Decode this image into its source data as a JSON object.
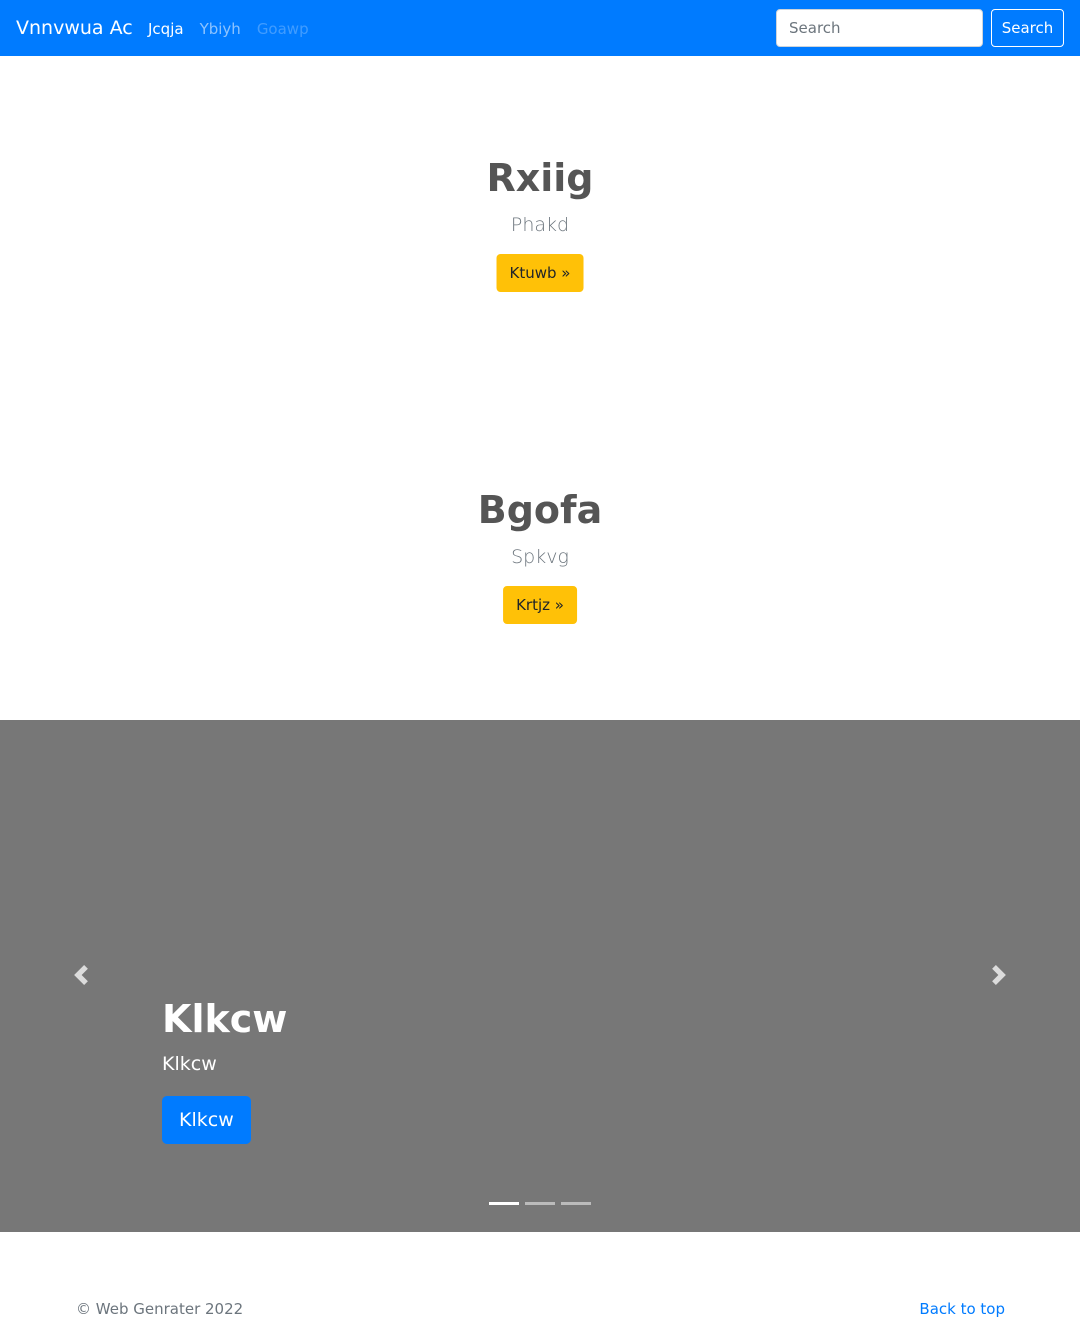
{
  "navbar": {
    "brand": "Vnnvwua Ac",
    "links": [
      {
        "label": "Jcqja",
        "state": "active"
      },
      {
        "label": "Ybiyh",
        "state": "normal"
      },
      {
        "label": "Goawp",
        "state": "disabled"
      }
    ],
    "search_placeholder": "Search",
    "search_button": "Search"
  },
  "hero1": {
    "title": "Rxiig",
    "subtitle": "Phakd",
    "button": "Ktuwb »"
  },
  "hero2": {
    "title": "Bgofa",
    "subtitle": "Spkvg",
    "button": "Krtjz »"
  },
  "carousel": {
    "caption_title": "Klkcw",
    "caption_subtitle": "Klkcw",
    "caption_button": "Klkcw",
    "active_slide": 1,
    "slide_count": 3,
    "prev_icon": "chevron-left-icon",
    "next_icon": "chevron-right-icon"
  },
  "footer": {
    "copyright": "© Web Genrater 2022",
    "back_to_top": "Back to top"
  },
  "colors": {
    "primary": "#007bff",
    "warning": "#ffc107",
    "carousel_bg": "#777777"
  }
}
